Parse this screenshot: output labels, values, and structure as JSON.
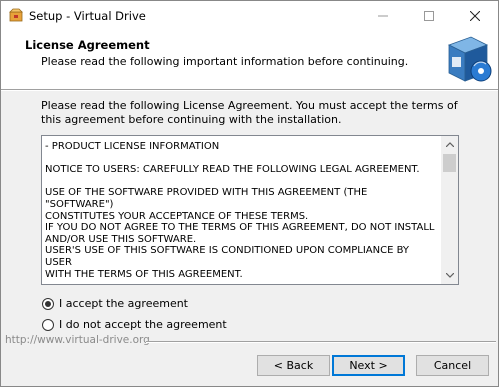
{
  "window": {
    "title": "Setup - Virtual Drive"
  },
  "header": {
    "title": "License Agreement",
    "subtitle": "Please read the following important information before continuing."
  },
  "intro_text": "Please read the following License Agreement. You must accept the terms of this agreement before continuing with the installation.",
  "license_text": "- PRODUCT LICENSE INFORMATION\n\nNOTICE TO USERS: CAREFULLY READ THE FOLLOWING LEGAL AGREEMENT.\n\nUSE OF THE SOFTWARE PROVIDED WITH THIS AGREEMENT (THE \"SOFTWARE\")\nCONSTITUTES YOUR ACCEPTANCE OF THESE TERMS.\nIF YOU DO NOT AGREE TO THE TERMS OF THIS AGREEMENT, DO NOT INSTALL\nAND/OR USE THIS SOFTWARE.\nUSER'S USE OF THIS SOFTWARE IS CONDITIONED UPON COMPLIANCE BY USER\nWITH THE TERMS OF THIS AGREEMENT.",
  "options": {
    "accept_label": "I accept the agreement",
    "decline_label": "I do not accept the agreement",
    "selected": "accept"
  },
  "footer": {
    "url": "http://www.virtual-drive.org"
  },
  "buttons": {
    "back": "< Back",
    "next": "Next >",
    "cancel": "Cancel"
  },
  "icons": {
    "app": "installer-box-icon",
    "header": "software-box-cd-icon",
    "minimize": "minimize-icon",
    "maximize": "maximize-icon",
    "close": "close-icon",
    "scroll_up": "chevron-up-icon",
    "scroll_down": "chevron-down-icon"
  },
  "colors": {
    "accent": "#0078d7",
    "header_bg": "#ffffff",
    "body_bg": "#f0f0f0"
  }
}
